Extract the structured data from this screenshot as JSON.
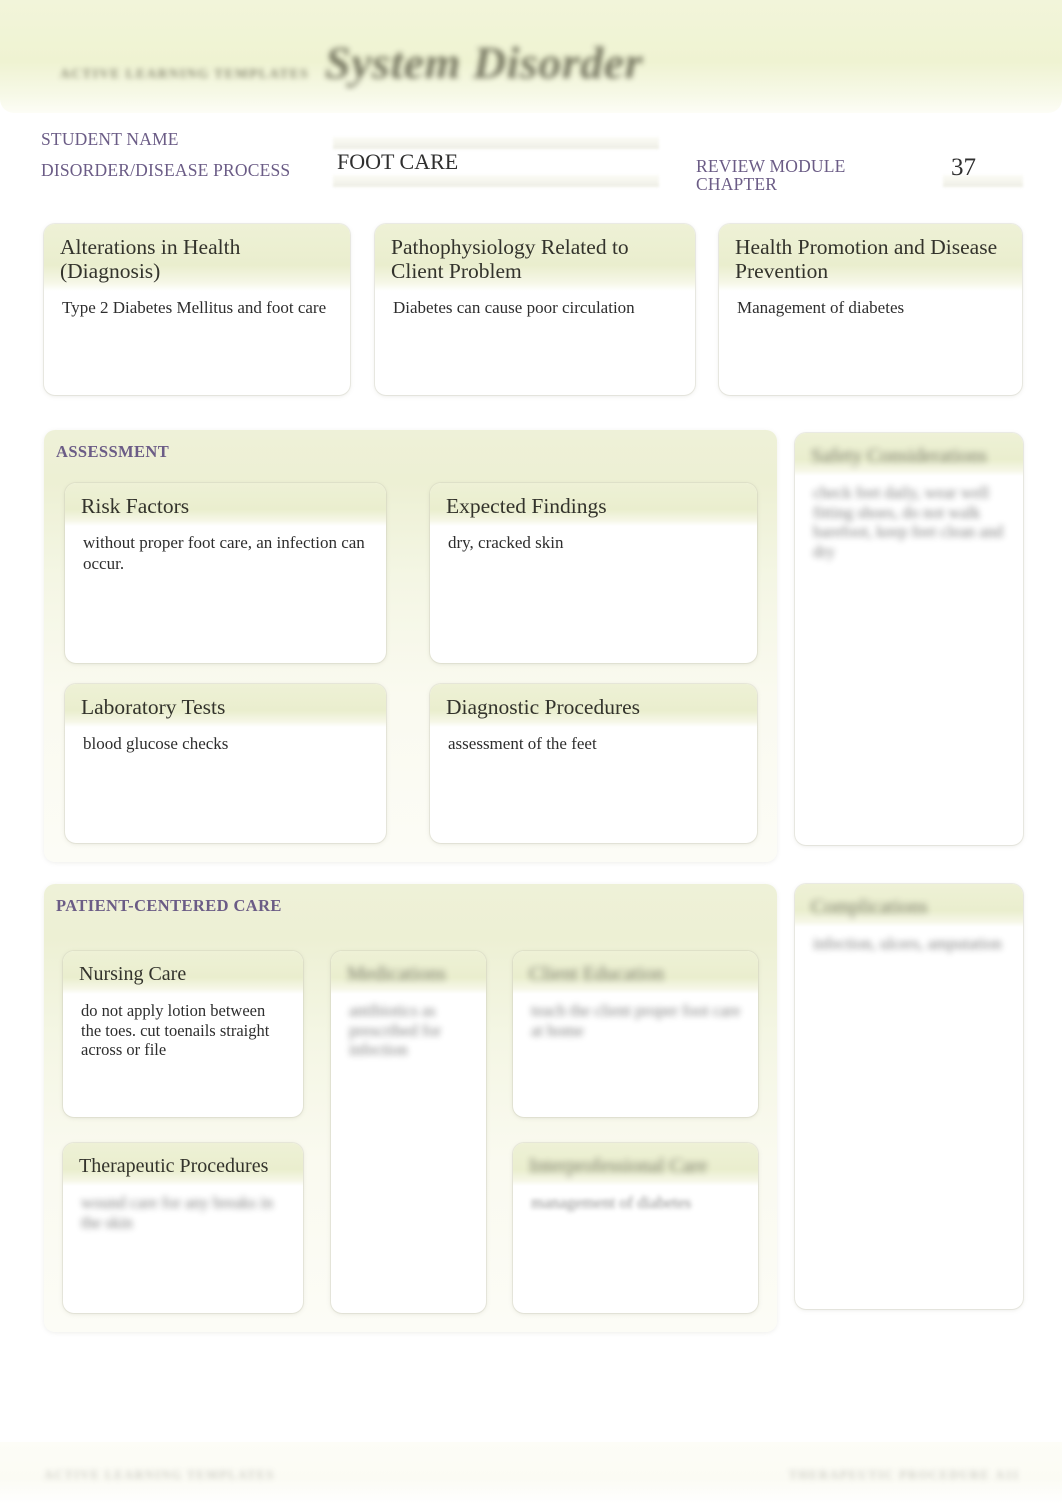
{
  "banner": {
    "brand": "ACTIVE LEARNING TEMPLATES",
    "title": "System Disorder"
  },
  "header": {
    "student_name_label": "STUDENT NAME",
    "student_name_value": "",
    "disorder_label": "DISORDER/DISEASE PROCESS",
    "disorder_value": "FOOT CARE",
    "review_module_label": "REVIEW MODULE CHAPTER",
    "chapter_value": "37"
  },
  "top_cards": [
    {
      "title": "Alterations in Health (Diagnosis)",
      "body": "Type 2 Diabetes Mellitus and foot care"
    },
    {
      "title": "Pathophysiology Related to Client Problem",
      "body": "Diabetes can cause poor circulation"
    },
    {
      "title": "Health Promotion and Disease Prevention",
      "body": "Management of diabetes"
    }
  ],
  "assessment": {
    "section_label": "ASSESSMENT",
    "cards": [
      {
        "title": "Risk Factors",
        "body": "without proper foot care, an infection can occur."
      },
      {
        "title": "Expected Findings",
        "body": "dry, cracked skin"
      },
      {
        "title": "Laboratory Tests",
        "body": "blood glucose checks"
      },
      {
        "title": "Diagnostic Procedures",
        "body": "assessment of the feet"
      }
    ]
  },
  "safety": {
    "title": "Safety Considerations",
    "body": "check feet daily, wear well fitting shoes, do not walk barefoot, keep feet clean and dry"
  },
  "patient_centered_care": {
    "section_label": "PATIENT-CENTERED CARE",
    "cards": [
      {
        "title": "Nursing Care",
        "body": "do not apply lotion between the toes. cut toenails straight across or file"
      },
      {
        "title": "Medications",
        "body": "antibiotics as prescribed for infection"
      },
      {
        "title": "Client Education",
        "body": "teach the client proper foot care at home"
      },
      {
        "title": "Therapeutic Procedures",
        "body": "wound care for any breaks in the skin"
      },
      {
        "title": "Interprofessional Care",
        "body": "management of diabetes"
      }
    ]
  },
  "complications": {
    "title": "Complications",
    "body": "infection, ulcers, amputation"
  },
  "footer": {
    "left": "ACTIVE LEARNING TEMPLATES",
    "right": "THERAPEUTIC PROCEDURE",
    "page": "A11"
  },
  "colors": {
    "banner_green": "#eff3d2",
    "card_head_green": "#eaeece",
    "label_purple": "#6b5c86",
    "text_dark": "#2e2e2e"
  }
}
